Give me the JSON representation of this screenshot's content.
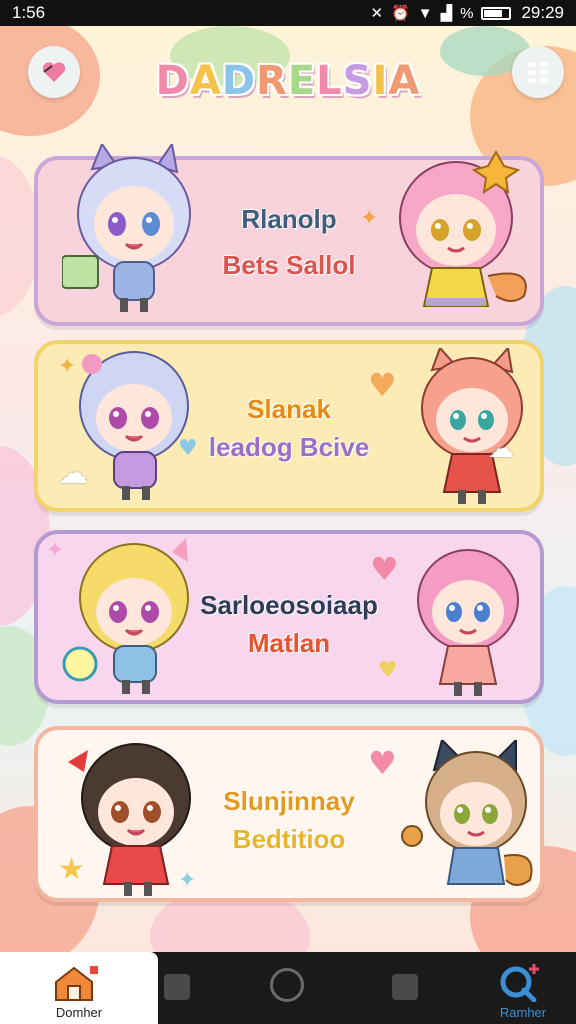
{
  "status_bar": {
    "time": "1:56",
    "battery_percent_symbol": "%",
    "clock_right": "29:29"
  },
  "header": {
    "title_letters": [
      "D",
      "A",
      "D",
      "R",
      "E",
      "L",
      "S",
      "I",
      "A"
    ],
    "back_icon": "back-heart-icon",
    "menu_icon": "grid-menu-icon"
  },
  "cards": [
    {
      "line1": "Rlanolp",
      "line2": "Bets Sallol",
      "line1_color": "#3f5d7d",
      "line2_color": "#d9534f",
      "bg": "#f9d3dc",
      "border": "#c9a6d8"
    },
    {
      "line1": "Slanak",
      "line2": "leadog Bcive",
      "line1_color": "#e58a14",
      "line2_color": "#9c6fc6",
      "bg": "#fcebb4",
      "border": "#f2d46a"
    },
    {
      "line1": "Sarloeosoiaap",
      "line2": "Matlan",
      "line1_color": "#2e3c5a",
      "line2_color": "#e3542f",
      "bg": "#f8d7ee",
      "border": "#b39bd2"
    },
    {
      "line1": "Slunjinnay",
      "line2": "Bedtitioo",
      "line1_color": "#e39a1f",
      "line2_color": "#e8b52a",
      "bg": "#fff6ef",
      "border": "#f3b79f"
    }
  ],
  "nav": {
    "home_label": "Domher",
    "search_label": "Ramher"
  },
  "colors": {
    "accent_pink": "#f08aa8",
    "accent_blue": "#3a8fd6",
    "nav_bg": "#1a1a1a"
  }
}
